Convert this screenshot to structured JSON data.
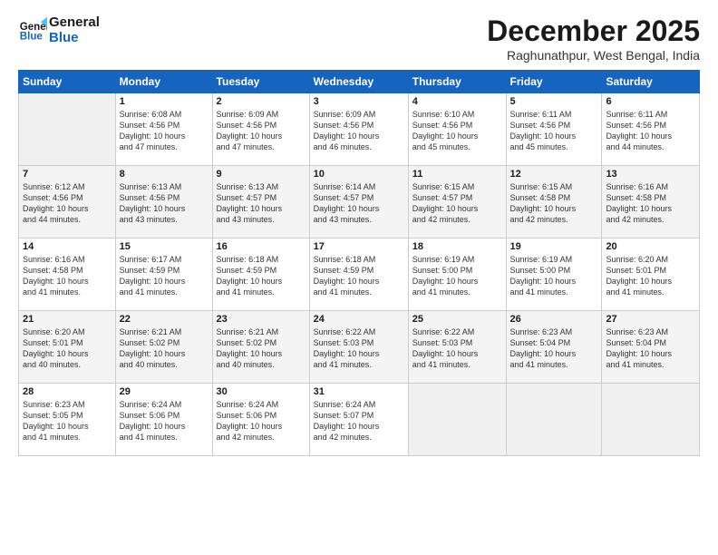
{
  "logo": {
    "line1": "General",
    "line2": "Blue"
  },
  "title": "December 2025",
  "subtitle": "Raghunathpur, West Bengal, India",
  "weekdays": [
    "Sunday",
    "Monday",
    "Tuesday",
    "Wednesday",
    "Thursday",
    "Friday",
    "Saturday"
  ],
  "weeks": [
    [
      {
        "day": "",
        "info": ""
      },
      {
        "day": "1",
        "info": "Sunrise: 6:08 AM\nSunset: 4:56 PM\nDaylight: 10 hours\nand 47 minutes."
      },
      {
        "day": "2",
        "info": "Sunrise: 6:09 AM\nSunset: 4:56 PM\nDaylight: 10 hours\nand 47 minutes."
      },
      {
        "day": "3",
        "info": "Sunrise: 6:09 AM\nSunset: 4:56 PM\nDaylight: 10 hours\nand 46 minutes."
      },
      {
        "day": "4",
        "info": "Sunrise: 6:10 AM\nSunset: 4:56 PM\nDaylight: 10 hours\nand 45 minutes."
      },
      {
        "day": "5",
        "info": "Sunrise: 6:11 AM\nSunset: 4:56 PM\nDaylight: 10 hours\nand 45 minutes."
      },
      {
        "day": "6",
        "info": "Sunrise: 6:11 AM\nSunset: 4:56 PM\nDaylight: 10 hours\nand 44 minutes."
      }
    ],
    [
      {
        "day": "7",
        "info": "Sunrise: 6:12 AM\nSunset: 4:56 PM\nDaylight: 10 hours\nand 44 minutes."
      },
      {
        "day": "8",
        "info": "Sunrise: 6:13 AM\nSunset: 4:56 PM\nDaylight: 10 hours\nand 43 minutes."
      },
      {
        "day": "9",
        "info": "Sunrise: 6:13 AM\nSunset: 4:57 PM\nDaylight: 10 hours\nand 43 minutes."
      },
      {
        "day": "10",
        "info": "Sunrise: 6:14 AM\nSunset: 4:57 PM\nDaylight: 10 hours\nand 43 minutes."
      },
      {
        "day": "11",
        "info": "Sunrise: 6:15 AM\nSunset: 4:57 PM\nDaylight: 10 hours\nand 42 minutes."
      },
      {
        "day": "12",
        "info": "Sunrise: 6:15 AM\nSunset: 4:58 PM\nDaylight: 10 hours\nand 42 minutes."
      },
      {
        "day": "13",
        "info": "Sunrise: 6:16 AM\nSunset: 4:58 PM\nDaylight: 10 hours\nand 42 minutes."
      }
    ],
    [
      {
        "day": "14",
        "info": "Sunrise: 6:16 AM\nSunset: 4:58 PM\nDaylight: 10 hours\nand 41 minutes."
      },
      {
        "day": "15",
        "info": "Sunrise: 6:17 AM\nSunset: 4:59 PM\nDaylight: 10 hours\nand 41 minutes."
      },
      {
        "day": "16",
        "info": "Sunrise: 6:18 AM\nSunset: 4:59 PM\nDaylight: 10 hours\nand 41 minutes."
      },
      {
        "day": "17",
        "info": "Sunrise: 6:18 AM\nSunset: 4:59 PM\nDaylight: 10 hours\nand 41 minutes."
      },
      {
        "day": "18",
        "info": "Sunrise: 6:19 AM\nSunset: 5:00 PM\nDaylight: 10 hours\nand 41 minutes."
      },
      {
        "day": "19",
        "info": "Sunrise: 6:19 AM\nSunset: 5:00 PM\nDaylight: 10 hours\nand 41 minutes."
      },
      {
        "day": "20",
        "info": "Sunrise: 6:20 AM\nSunset: 5:01 PM\nDaylight: 10 hours\nand 41 minutes."
      }
    ],
    [
      {
        "day": "21",
        "info": "Sunrise: 6:20 AM\nSunset: 5:01 PM\nDaylight: 10 hours\nand 40 minutes."
      },
      {
        "day": "22",
        "info": "Sunrise: 6:21 AM\nSunset: 5:02 PM\nDaylight: 10 hours\nand 40 minutes."
      },
      {
        "day": "23",
        "info": "Sunrise: 6:21 AM\nSunset: 5:02 PM\nDaylight: 10 hours\nand 40 minutes."
      },
      {
        "day": "24",
        "info": "Sunrise: 6:22 AM\nSunset: 5:03 PM\nDaylight: 10 hours\nand 41 minutes."
      },
      {
        "day": "25",
        "info": "Sunrise: 6:22 AM\nSunset: 5:03 PM\nDaylight: 10 hours\nand 41 minutes."
      },
      {
        "day": "26",
        "info": "Sunrise: 6:23 AM\nSunset: 5:04 PM\nDaylight: 10 hours\nand 41 minutes."
      },
      {
        "day": "27",
        "info": "Sunrise: 6:23 AM\nSunset: 5:04 PM\nDaylight: 10 hours\nand 41 minutes."
      }
    ],
    [
      {
        "day": "28",
        "info": "Sunrise: 6:23 AM\nSunset: 5:05 PM\nDaylight: 10 hours\nand 41 minutes."
      },
      {
        "day": "29",
        "info": "Sunrise: 6:24 AM\nSunset: 5:06 PM\nDaylight: 10 hours\nand 41 minutes."
      },
      {
        "day": "30",
        "info": "Sunrise: 6:24 AM\nSunset: 5:06 PM\nDaylight: 10 hours\nand 42 minutes."
      },
      {
        "day": "31",
        "info": "Sunrise: 6:24 AM\nSunset: 5:07 PM\nDaylight: 10 hours\nand 42 minutes."
      },
      {
        "day": "",
        "info": ""
      },
      {
        "day": "",
        "info": ""
      },
      {
        "day": "",
        "info": ""
      }
    ]
  ]
}
